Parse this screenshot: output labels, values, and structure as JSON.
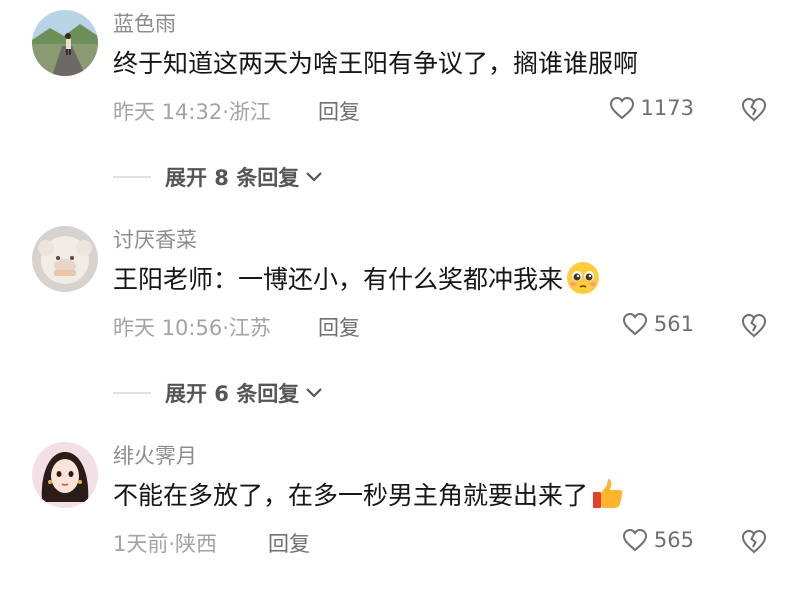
{
  "comments": [
    {
      "username": "蓝色雨",
      "text": "终于知道这两天为啥王阳有争议了，搁谁谁服啊",
      "meta": "昨天 14:32·浙江",
      "reply_label": "回复",
      "likes": "1173",
      "expand_label": "展开 8 条回复",
      "avatar_icon": "roadside-photo-avatar"
    },
    {
      "username": "讨厌香菜",
      "text": "王阳老师：一博还小，有什么奖都冲我来",
      "meta": "昨天 10:56·江苏",
      "reply_label": "回复",
      "likes": "561",
      "emoji_icon": "pleading-face-emoji",
      "expand_label": "展开 6 条回复",
      "avatar_icon": "plush-toy-avatar"
    },
    {
      "username": "绯火霁月",
      "text": "不能在多放了，在多一秒男主角就要出来了",
      "meta": "1天前·陕西",
      "reply_label": "回复",
      "likes": "565",
      "emoji_icon": "thumbs-up-emoji",
      "avatar_icon": "cartoon-girl-avatar"
    }
  ]
}
